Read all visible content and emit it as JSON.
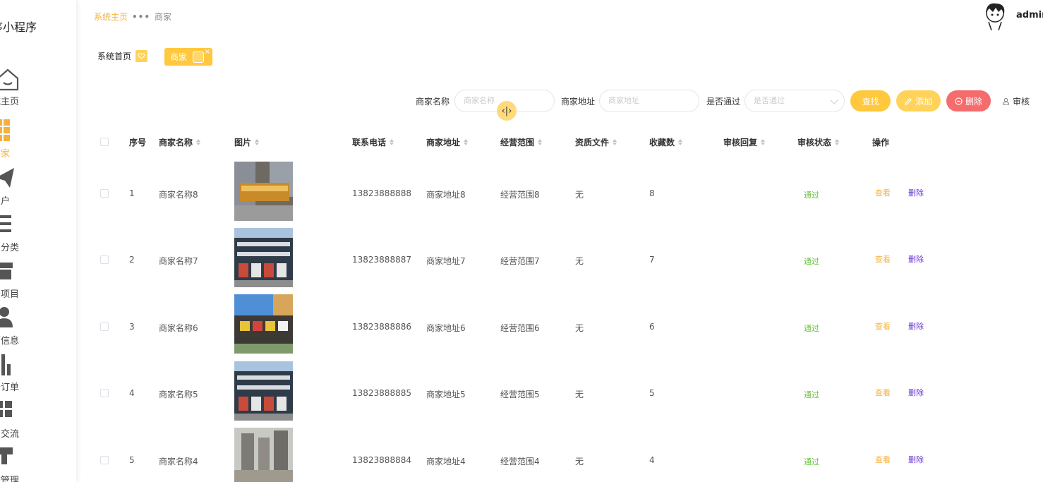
{
  "app": {
    "title": "序小程序"
  },
  "sidebar": {
    "items": [
      {
        "label": "统主页",
        "icon": "home-icon"
      },
      {
        "label": "商家",
        "icon": "grid-icon"
      },
      {
        "label": "用户",
        "icon": "paper-plane-icon"
      },
      {
        "label": "目分类",
        "icon": "list-icon"
      },
      {
        "label": "务项目",
        "icon": "store-icon"
      },
      {
        "label": "师信息",
        "icon": "person-icon"
      },
      {
        "label": "务订单",
        "icon": "bar-chart-icon"
      },
      {
        "label": "团交流",
        "icon": "apps-icon"
      },
      {
        "label": "统管理",
        "icon": "table-icon"
      }
    ]
  },
  "header": {
    "breadcrumb": {
      "home": "系统主页",
      "dots": "•••",
      "current": "商家"
    },
    "user": {
      "name": "admin"
    }
  },
  "tags": {
    "home": "系统首页",
    "active": "商家",
    "close": "×"
  },
  "search": {
    "name_label": "商家名称",
    "name_placeholder": "商家名称",
    "address_label": "商家地址",
    "address_placeholder": "商家地址",
    "passed_label": "是否通过",
    "passed_placeholder": "是否通过",
    "search_button": "查找",
    "add_button": "添加",
    "delete_button": "删除",
    "audit_button": "审核"
  },
  "table": {
    "headers": {
      "index": "序号",
      "name": "商家名称",
      "image": "图片",
      "phone": "联系电话",
      "address": "商家地址",
      "scope": "经营范围",
      "license": "资质文件",
      "favorites": "收藏数",
      "reply": "审核回复",
      "status": "审核状态",
      "actions": "操作"
    },
    "rows": [
      {
        "index": "1",
        "name": "商家名称8",
        "phone": "13823888888",
        "address": "商家地址8",
        "scope": "经营范围8",
        "license": "无",
        "favorites": "8",
        "reply": "",
        "status": "通过",
        "view": "查看",
        "del": "删除"
      },
      {
        "index": "2",
        "name": "商家名称7",
        "phone": "13823888887",
        "address": "商家地址7",
        "scope": "经营范围7",
        "license": "无",
        "favorites": "7",
        "reply": "",
        "status": "通过",
        "view": "查看",
        "del": "删除"
      },
      {
        "index": "3",
        "name": "商家名称6",
        "phone": "13823888886",
        "address": "商家地址6",
        "scope": "经营范围6",
        "license": "无",
        "favorites": "6",
        "reply": "",
        "status": "通过",
        "view": "查看",
        "del": "删除"
      },
      {
        "index": "4",
        "name": "商家名称5",
        "phone": "13823888885",
        "address": "商家地址5",
        "scope": "经营范围5",
        "license": "无",
        "favorites": "5",
        "reply": "",
        "status": "通过",
        "view": "查看",
        "del": "删除"
      },
      {
        "index": "5",
        "name": "商家名称4",
        "phone": "13823888884",
        "address": "商家地址4",
        "scope": "经营范围4",
        "license": "无",
        "favorites": "4",
        "reply": "",
        "status": "通过",
        "view": "查看",
        "del": "删除"
      }
    ]
  },
  "colors": {
    "accent": "#ffc83d",
    "accent_text": "#f6b13b",
    "danger": "#f56c6c",
    "success": "#67c23a",
    "link_purple": "#6b3bd1"
  }
}
